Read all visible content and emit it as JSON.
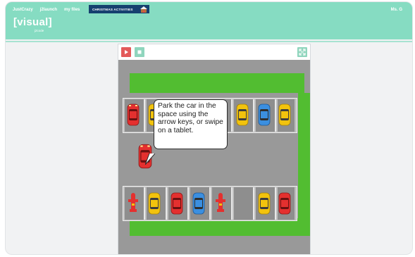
{
  "nav": {
    "items": [
      "JustCrazy",
      "j2launch",
      "my files"
    ],
    "banner": "CHRISTMAS ACTIVITIES",
    "user": "Ms. G"
  },
  "logo": {
    "word": "[visual]",
    "sub": "j2code"
  },
  "toolbar": {
    "play": "play-icon",
    "stop": "stop-icon",
    "fullscreen": "fullscreen-icon"
  },
  "game": {
    "instruction": "Park the car in the space using the arrow keys, or swipe on a tablet.",
    "colors": {
      "grass": "#52bd31",
      "road": "#999999",
      "bay": "#8e8e8e",
      "red": "#e4302f",
      "yellow": "#f2c30d",
      "blue": "#3b8fe0"
    },
    "top_row": [
      "red",
      "yellow",
      "",
      "",
      "",
      "yellow",
      "blue",
      "yellow"
    ],
    "bottom_row": [
      "hydrant",
      "yellow",
      "red",
      "blue",
      "hydrant",
      "",
      "yellow",
      "red"
    ],
    "player_car": "red"
  },
  "colors": {
    "header": "#86dcc2",
    "accent_red": "#e35a5a",
    "accent_green": "#8fd5bd",
    "banner": "#16406f"
  }
}
